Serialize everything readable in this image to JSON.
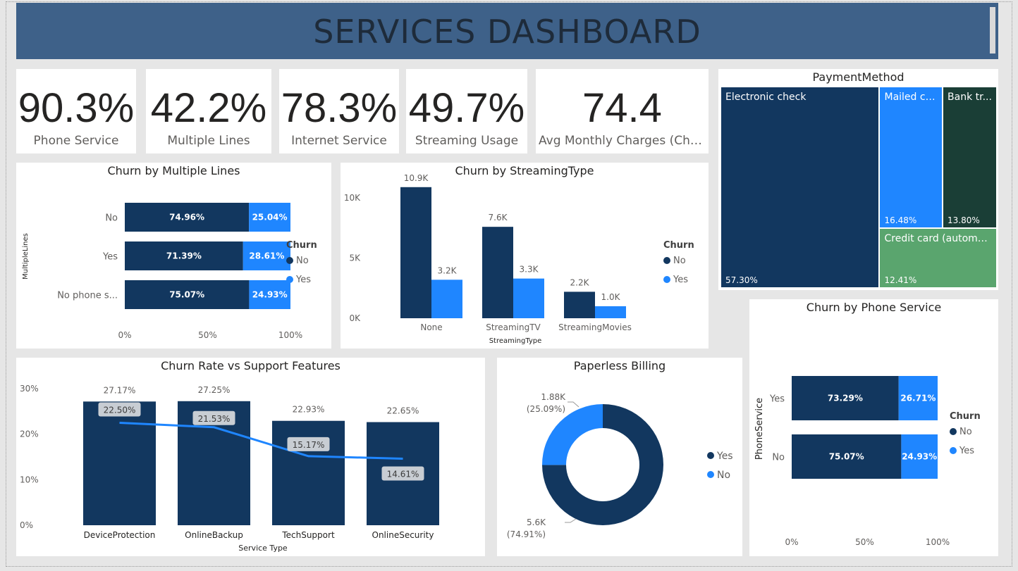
{
  "header": {
    "title": "SERVICES DASHBOARD"
  },
  "kpis": [
    {
      "value": "90.3%",
      "label": "Phone Service"
    },
    {
      "value": "42.2%",
      "label": "Multiple Lines"
    },
    {
      "value": "78.3%",
      "label": "Internet Service"
    },
    {
      "value": "49.7%",
      "label": "Streaming Usage"
    },
    {
      "value": "74.4",
      "label": "Avg Monthly Charges (Churned)"
    }
  ],
  "colors": {
    "no": "#12375f",
    "yes": "#1f86ff",
    "bank": "#1a3e36",
    "credit": "#5aa56e",
    "header": "#3e6189",
    "label_box": "#c8cdd3"
  },
  "legend": {
    "title": "Churn",
    "no": "No",
    "yes": "Yes"
  },
  "chart_data": [
    {
      "id": "multiple_lines",
      "type": "bar",
      "orientation": "horizontal",
      "stacked": "100%",
      "title": "Churn by Multiple Lines",
      "ylabel": "MultipleLines",
      "categories": [
        "No",
        "Yes",
        "No phone service"
      ],
      "category_display": [
        "No",
        "Yes",
        "No phone s..."
      ],
      "series": [
        {
          "name": "No",
          "values": [
            74.96,
            71.39,
            75.07
          ],
          "labels": [
            "74.96%",
            "71.39%",
            "75.07%"
          ]
        },
        {
          "name": "Yes",
          "values": [
            25.04,
            28.61,
            24.93
          ],
          "labels": [
            "25.04%",
            "28.61%",
            "24.93%"
          ]
        }
      ],
      "xticks": [
        "0%",
        "50%",
        "100%"
      ],
      "legend_position": "right"
    },
    {
      "id": "streaming",
      "type": "bar",
      "title": "Churn by StreamingType",
      "xlabel": "StreamingType",
      "categories": [
        "None",
        "StreamingTV",
        "StreamingMovies"
      ],
      "series": [
        {
          "name": "No",
          "values": [
            10900,
            7600,
            2200
          ],
          "labels": [
            "10.9K",
            "7.6K",
            "2.2K"
          ]
        },
        {
          "name": "Yes",
          "values": [
            3200,
            3300,
            1000
          ],
          "labels": [
            "3.2K",
            "3.3K",
            "1.0K"
          ]
        }
      ],
      "yticks": [
        "0K",
        "5K",
        "10K"
      ],
      "ylim": [
        0,
        12000
      ],
      "legend_position": "right"
    },
    {
      "id": "payment",
      "type": "treemap",
      "title": "PaymentMethod",
      "items": [
        {
          "name": "Electronic check",
          "value": 57.3,
          "label": "57.30%"
        },
        {
          "name": "Mailed check",
          "display": "Mailed ch...",
          "value": 16.48,
          "label": "16.48%"
        },
        {
          "name": "Bank transfer (automatic)",
          "display": "Bank tr...",
          "value": 13.8,
          "label": "13.80%"
        },
        {
          "name": "Credit card (automatic)",
          "value": 12.41,
          "label": "12.41%"
        }
      ]
    },
    {
      "id": "support",
      "type": "bar",
      "combo_line": true,
      "title": "Churn Rate vs Support Features",
      "xlabel": "Service Type",
      "categories": [
        "DeviceProtection",
        "OnlineBackup",
        "TechSupport",
        "OnlineSecurity"
      ],
      "bars": {
        "values": [
          27.17,
          27.25,
          22.93,
          22.65
        ],
        "labels": [
          "27.17%",
          "27.25%",
          "22.93%",
          "22.65%"
        ]
      },
      "line": {
        "values": [
          22.5,
          21.53,
          15.17,
          14.61
        ],
        "labels": [
          "22.50%",
          "21.53%",
          "15.17%",
          "14.61%"
        ]
      },
      "yticks": [
        "0%",
        "10%",
        "20%",
        "30%"
      ],
      "ylim": [
        0,
        30
      ]
    },
    {
      "id": "paperless",
      "type": "pie",
      "donut": true,
      "title": "Paperless Billing",
      "slices": [
        {
          "name": "Yes",
          "value": 74.91,
          "label_count": "5.6K",
          "label_pct": "(74.91%)"
        },
        {
          "name": "No",
          "value": 25.09,
          "label_count": "1.88K",
          "label_pct": "(25.09%)"
        }
      ],
      "legend": [
        "Yes",
        "No"
      ],
      "legend_position": "right"
    },
    {
      "id": "phone",
      "type": "bar",
      "orientation": "horizontal",
      "stacked": "100%",
      "title": "Churn by Phone Service",
      "ylabel": "PhoneService",
      "categories": [
        "Yes",
        "No"
      ],
      "series": [
        {
          "name": "No",
          "values": [
            73.29,
            75.07
          ],
          "labels": [
            "73.29%",
            "75.07%"
          ]
        },
        {
          "name": "Yes",
          "values": [
            26.71,
            24.93
          ],
          "labels": [
            "26.71%",
            "24.93%"
          ]
        }
      ],
      "xticks": [
        "0%",
        "50%",
        "100%"
      ],
      "legend_position": "right"
    }
  ]
}
